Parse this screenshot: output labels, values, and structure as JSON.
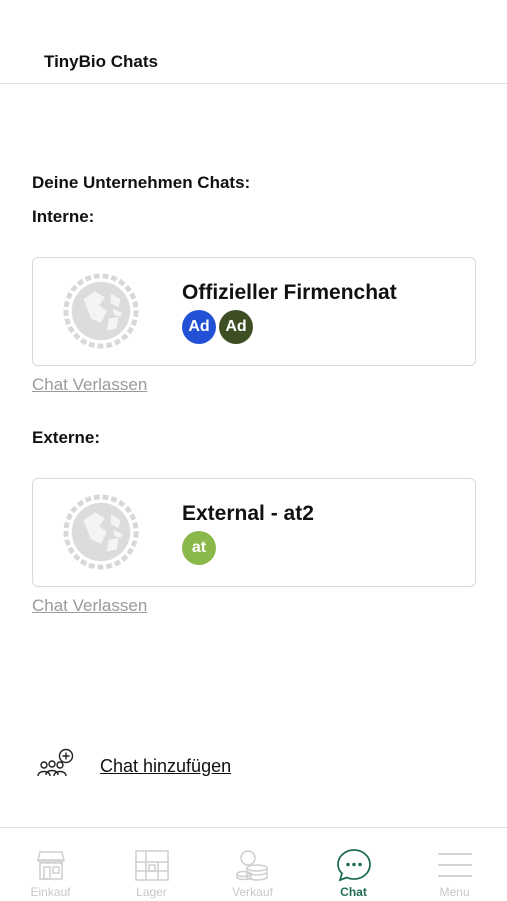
{
  "header": {
    "title": "TinyBio Chats"
  },
  "main": {
    "section_title": "Deine Unternehmen Chats:",
    "internal": {
      "label": "Interne:",
      "chats": [
        {
          "name": "Offizieller Firmenchat",
          "members": [
            {
              "initials": "Ad",
              "color": "#2251d6"
            },
            {
              "initials": "Ad",
              "color": "#3d4e22"
            }
          ],
          "leave_label": "Chat Verlassen"
        }
      ]
    },
    "external": {
      "label": "Externe:",
      "chats": [
        {
          "name": "External - at2",
          "members": [
            {
              "initials": "at",
              "color": "#8ab84a"
            }
          ],
          "leave_label": "Chat Verlassen"
        }
      ]
    },
    "add_chat": {
      "label": "Chat hinzufügen",
      "icon": "add-group-icon"
    }
  },
  "tabbar": {
    "active_color": "#1f6e53",
    "tabs": [
      {
        "label": "Einkauf",
        "icon": "shop-icon",
        "active": false
      },
      {
        "label": "Lager",
        "icon": "warehouse-icon",
        "active": false
      },
      {
        "label": "Verkauf",
        "icon": "coins-icon",
        "active": false
      },
      {
        "label": "Chat",
        "icon": "chat-bubble-icon",
        "active": true
      },
      {
        "label": "Menu",
        "icon": "hamburger-menu-icon",
        "active": false
      }
    ]
  }
}
